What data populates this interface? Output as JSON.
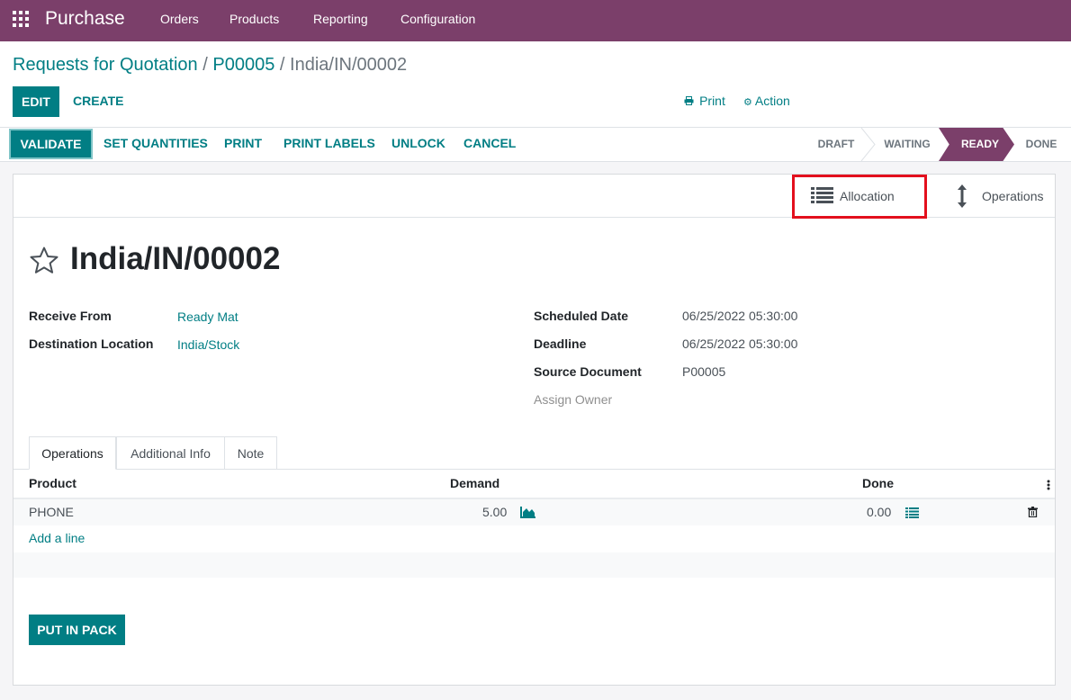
{
  "app": {
    "name": "Purchase",
    "menu": [
      "Orders",
      "Products",
      "Reporting",
      "Configuration"
    ]
  },
  "breadcrumb": {
    "items": [
      "Requests for Quotation",
      "P00005"
    ],
    "current": "India/IN/00002",
    "separator": "/"
  },
  "actions": {
    "edit": "EDIT",
    "create": "CREATE",
    "print": "Print",
    "action": "Action"
  },
  "statusbar": {
    "buttons": [
      "VALIDATE",
      "SET QUANTITIES",
      "PRINT",
      "PRINT LABELS",
      "UNLOCK",
      "CANCEL"
    ],
    "stages": [
      "DRAFT",
      "WAITING",
      "READY",
      "DONE"
    ],
    "current_stage": "READY"
  },
  "smart_buttons": {
    "allocation": "Allocation",
    "operations": "Operations"
  },
  "record": {
    "title": "India/IN/00002",
    "fields_left": [
      {
        "label": "Receive From",
        "value": "Ready Mat"
      },
      {
        "label": "Destination Location",
        "value": "India/Stock"
      }
    ],
    "fields_right": [
      {
        "label": "Scheduled Date",
        "value": "06/25/2022 05:30:00"
      },
      {
        "label": "Deadline",
        "value": "06/25/2022 05:30:00"
      },
      {
        "label": "Source Document",
        "value": "P00005"
      }
    ],
    "assign_owner": "Assign Owner"
  },
  "tabs": [
    "Operations",
    "Additional Info",
    "Note"
  ],
  "operations": {
    "columns": [
      "Product",
      "Demand",
      "Done"
    ],
    "rows": [
      {
        "product": "PHONE",
        "demand": "5.00",
        "done": "0.00"
      }
    ],
    "add_line": "Add a line"
  },
  "footer": {
    "put_in_pack": "PUT IN PACK"
  },
  "colors": {
    "brand": "#7b3f6a",
    "accent": "#017e84",
    "highlight": "#e3101d"
  }
}
